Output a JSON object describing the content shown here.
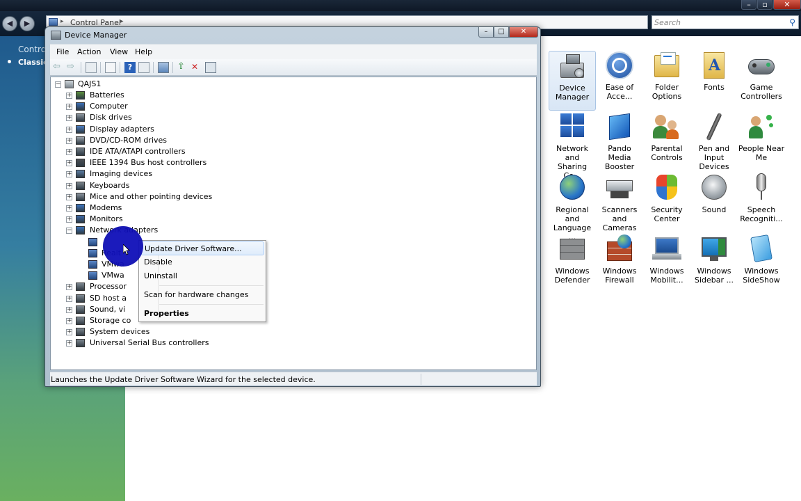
{
  "control_panel": {
    "address_text": "Control Panel",
    "address_separator": "▸",
    "search_placeholder": "Search",
    "sidebar": {
      "home_label": "Control",
      "classic_view_label": "Classic"
    },
    "items": [
      {
        "label1": "Device",
        "label2": "Manager",
        "icon": "device-manager-icon"
      },
      {
        "label1": "Ease of",
        "label2": "Acce...",
        "icon": "ease-of-access-icon"
      },
      {
        "label1": "Folder",
        "label2": "Options",
        "icon": "folder-options-icon"
      },
      {
        "label1": "Fonts",
        "label2": "",
        "icon": "fonts-icon"
      },
      {
        "label1": "Game",
        "label2": "Controllers",
        "icon": "game-controllers-icon"
      },
      {
        "label1": "Network and",
        "label2": "Sharing Ce...",
        "icon": "network-sharing-icon"
      },
      {
        "label1": "Pando Media",
        "label2": "Booster",
        "icon": "pando-media-booster-icon"
      },
      {
        "label1": "Parental",
        "label2": "Controls",
        "icon": "parental-controls-icon"
      },
      {
        "label1": "Pen and",
        "label2": "Input Devices",
        "icon": "pen-input-icon"
      },
      {
        "label1": "People Near",
        "label2": "Me",
        "icon": "people-near-me-icon"
      },
      {
        "label1": "Regional and",
        "label2": "Language ...",
        "icon": "regional-language-icon"
      },
      {
        "label1": "Scanners and",
        "label2": "Cameras",
        "icon": "scanners-cameras-icon"
      },
      {
        "label1": "Security",
        "label2": "Center",
        "icon": "security-center-icon"
      },
      {
        "label1": "Sound",
        "label2": "",
        "icon": "sound-icon"
      },
      {
        "label1": "Speech",
        "label2": "Recogniti...",
        "icon": "speech-recognition-icon"
      },
      {
        "label1": "Windows",
        "label2": "Defender",
        "icon": "windows-defender-icon"
      },
      {
        "label1": "Windows",
        "label2": "Firewall",
        "icon": "windows-firewall-icon"
      },
      {
        "label1": "Windows",
        "label2": "Mobilit...",
        "icon": "windows-mobility-icon"
      },
      {
        "label1": "Windows",
        "label2": "Sidebar ...",
        "icon": "windows-sidebar-icon"
      },
      {
        "label1": "Windows",
        "label2": "SideShow",
        "icon": "windows-sideshow-icon"
      }
    ]
  },
  "device_manager": {
    "title": "Device Manager",
    "menu": [
      "File",
      "Action",
      "View",
      "Help"
    ],
    "tree": {
      "root": "QAJS1",
      "categories": [
        "Batteries",
        "Computer",
        "Disk drives",
        "Display adapters",
        "DVD/CD-ROM drives",
        "IDE ATA/ATAPI controllers",
        "IEEE 1394 Bus host controllers",
        "Imaging devices",
        "Keyboards",
        "Mice and other pointing devices",
        "Modems",
        "Monitors",
        "Network adapters"
      ],
      "network_children": [
        "Realt",
        "VMwa",
        "VMwa"
      ],
      "categories_after": [
        "Processor",
        "SD host a",
        "Sound, vi",
        "Storage co",
        "System devices",
        "Universal Serial Bus controllers"
      ]
    },
    "status_text": "Launches the Update Driver Software Wizard for the selected device."
  },
  "context_menu": {
    "update_driver": "Update Driver Software...",
    "disable": "Disable",
    "uninstall": "Uninstall",
    "scan": "Scan for hardware changes",
    "properties": "Properties"
  },
  "colors": {
    "selection": "#3179d6",
    "cursor_highlight": "#0f0fb8",
    "sidebar_top": "#1f5a8d",
    "sidebar_bottom": "#6ab060"
  }
}
